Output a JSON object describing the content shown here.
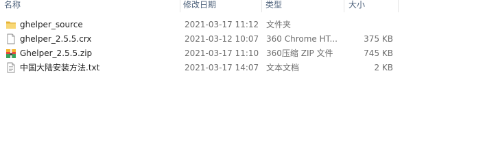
{
  "columns": {
    "name": "名称",
    "modified": "修改日期",
    "type": "类型",
    "size": "大小"
  },
  "files": [
    {
      "icon": "folder-icon",
      "name": "ghelper_source",
      "modified": "2021-03-17 11:12",
      "type": "文件夹",
      "size": ""
    },
    {
      "icon": "blank-file-icon",
      "name": "ghelper_2.5.5.crx",
      "modified": "2021-03-12 10:07",
      "type": "360 Chrome HT...",
      "size": "375 KB"
    },
    {
      "icon": "zip-archive-icon",
      "name": "Ghelper_2.5.5.zip",
      "modified": "2021-03-17 11:10",
      "type": "360压缩 ZIP 文件",
      "size": "745 KB"
    },
    {
      "icon": "text-file-icon",
      "name": "中国大陆安装方法.txt",
      "modified": "2021-03-17 14:07",
      "type": "文本文档",
      "size": "2 KB"
    }
  ]
}
